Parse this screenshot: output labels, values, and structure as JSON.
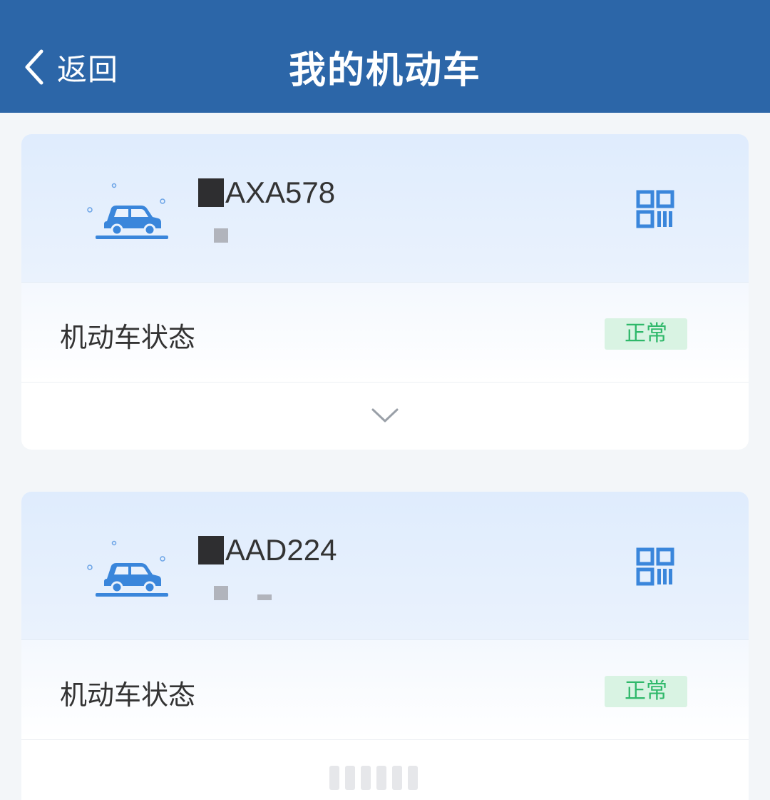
{
  "header": {
    "back_label": "返回",
    "title": "我的机动车",
    "background_color": "#2c66a8"
  },
  "vehicles": [
    {
      "plate": "AXA578",
      "status_label": "机动车状态",
      "status_value": "正常",
      "icons": [
        "car-icon",
        "qr-code-icon",
        "chevron-down-icon"
      ]
    },
    {
      "plate": "AAD224",
      "status_label": "机动车状态",
      "status_value": "正常",
      "icons": [
        "car-icon",
        "qr-code-icon"
      ]
    }
  ],
  "colors": {
    "accent": "#3a86db",
    "status_green": "#2fb86a",
    "status_badge_bg": "#d9f3e3"
  }
}
